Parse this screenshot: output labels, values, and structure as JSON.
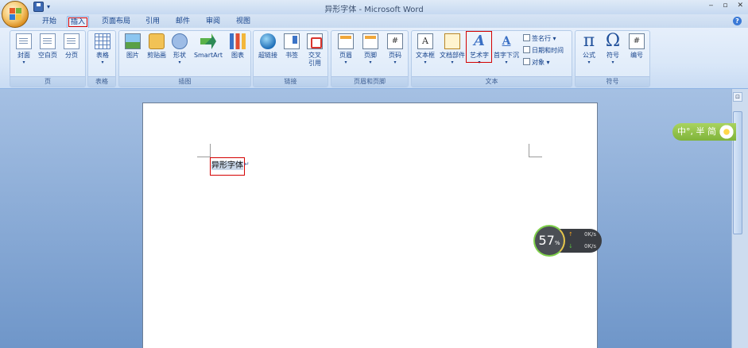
{
  "window": {
    "title": "异形字体 - Microsoft Word",
    "controls": [
      "‒",
      "▫",
      "✕"
    ]
  },
  "qat": {
    "dropdown": "▾"
  },
  "tabs": [
    "开始",
    "插入",
    "页面布局",
    "引用",
    "邮件",
    "审阅",
    "视图"
  ],
  "active_tab": "插入",
  "help": "?",
  "ribbon": {
    "groups": {
      "pages": {
        "label": "页",
        "buttons": [
          "封面",
          "空白页",
          "分页"
        ]
      },
      "tables": {
        "label": "表格",
        "buttons": [
          "表格"
        ]
      },
      "illustrations": {
        "label": "插图",
        "buttons": [
          "图片",
          "剪贴画",
          "形状",
          "SmartArt",
          "图表"
        ]
      },
      "links": {
        "label": "链接",
        "buttons": [
          "超链接",
          "书签",
          "交叉",
          "引用"
        ]
      },
      "header_footer": {
        "label": "页眉和页脚",
        "buttons": [
          "页眉",
          "页脚",
          "页码"
        ]
      },
      "text": {
        "label": "文本",
        "buttons": [
          "文本框",
          "文档部件",
          "艺术字",
          "首字下沉"
        ],
        "small": [
          "签名行 ▾",
          "日期和时间",
          "对象 ▾"
        ]
      },
      "symbols": {
        "label": "符号",
        "buttons": [
          "公式",
          "符号",
          "编号"
        ]
      }
    },
    "icon_glyphs": {
      "textbox": "A",
      "wordart": "A",
      "dropcap": "A",
      "equation": "π",
      "symbol": "Ω",
      "number": "#"
    }
  },
  "document": {
    "text": "异形字体",
    "paragraph_mark": "↵"
  },
  "ime": {
    "label": "中°, 半 简"
  },
  "network": {
    "percent": "57",
    "percent_unit": "%",
    "upload": "0K/s",
    "download": "0K/s"
  },
  "colors": {
    "highlight_red": "#d40000",
    "ribbon_text": "#15428b",
    "doc_background": "#6f96c9"
  }
}
